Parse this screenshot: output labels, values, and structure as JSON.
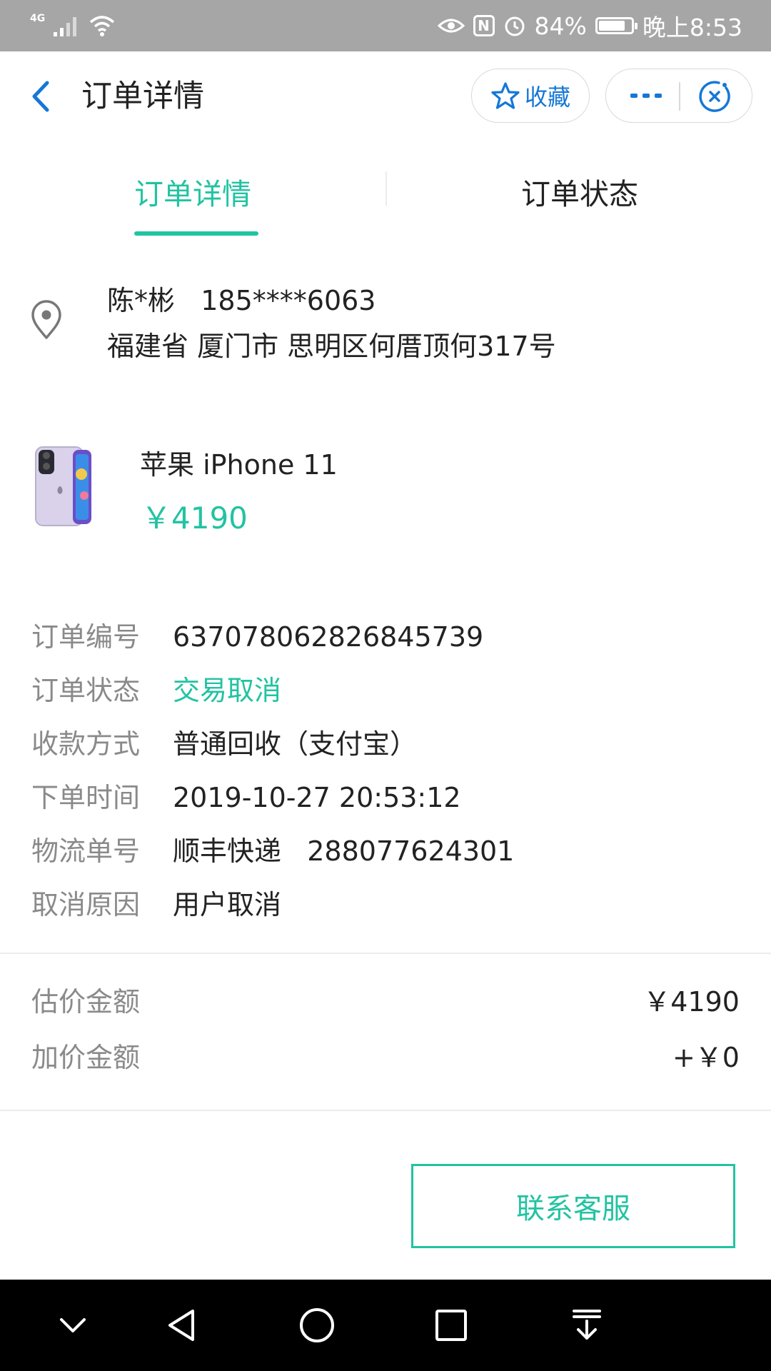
{
  "status_bar": {
    "network": "4G",
    "battery_percent": "84%",
    "battery_level": 0.84,
    "time": "晚上8:53",
    "nfc_label": "N"
  },
  "header": {
    "title": "订单详情",
    "favorite_label": "收藏"
  },
  "tabs": [
    {
      "label": "订单详情",
      "active": true
    },
    {
      "label": "订单状态",
      "active": false
    }
  ],
  "address": {
    "name_phone": "陈*彬   185****6063",
    "full": "福建省 厦门市 思明区何厝顶何317号"
  },
  "product": {
    "name": "苹果 iPhone 11",
    "price": "￥4190"
  },
  "order_info": [
    {
      "label": "订单编号",
      "value": "6370780628268457​39"
    },
    {
      "label": "订单状态",
      "value": "交易取消"
    },
    {
      "label": "收款方式",
      "value": "普通回收（支付宝）"
    },
    {
      "label": "下单时间",
      "value": "2019-10-27 20:53:12"
    },
    {
      "label": "物流单号",
      "value": "顺丰快递   288077624301"
    },
    {
      "label": "取消原因",
      "value": "用户取消"
    }
  ],
  "amounts": [
    {
      "label": "估价金额",
      "value": "￥4190"
    },
    {
      "label": "加价金额",
      "value": "+￥0"
    }
  ],
  "contact_button": "联系客服",
  "colors": {
    "accent_green": "#22c3a2",
    "link_blue": "#1677d6",
    "status_bar": "#a6a6a6"
  }
}
